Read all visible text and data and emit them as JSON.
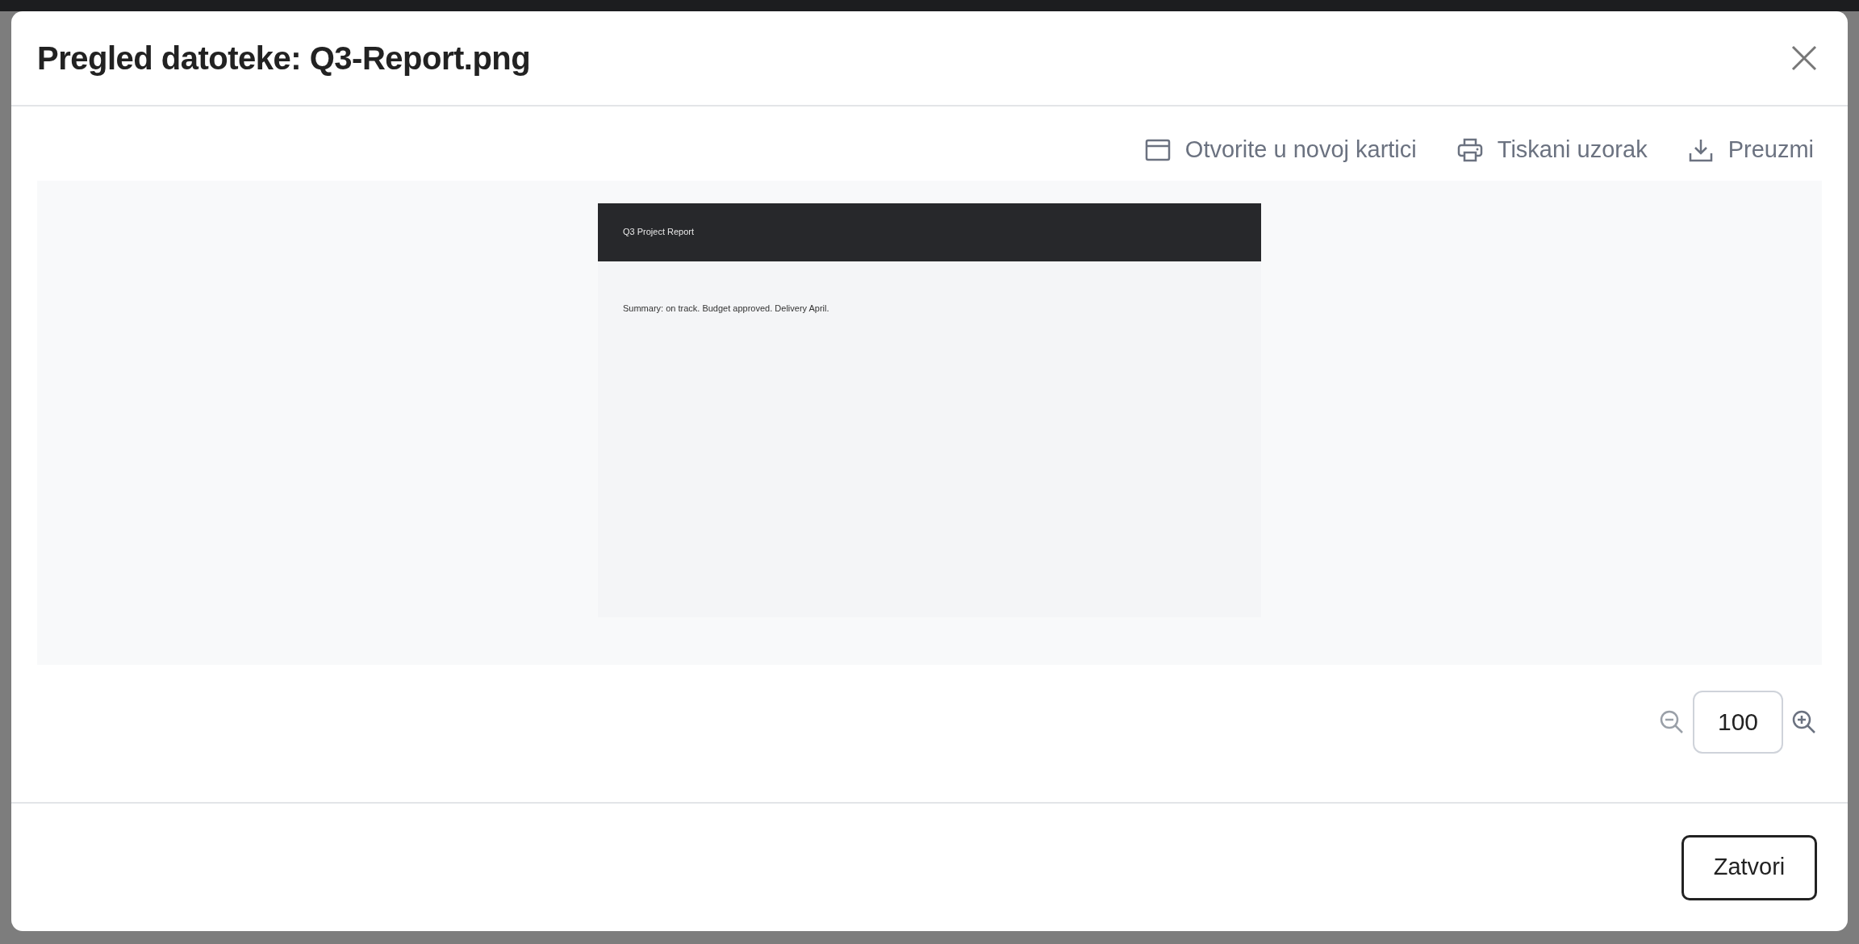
{
  "dialog": {
    "title": "Pregled datoteke: Q3-Report.png",
    "actions": [
      {
        "kind": "window",
        "label": "Otvorite u novoj kartici"
      },
      {
        "kind": "print",
        "label": "Tiskani uzorak"
      },
      {
        "kind": "download",
        "label": "Preuzmi"
      }
    ],
    "preview": {
      "header": "Q3 Project Report",
      "body": "Summary: on track. Budget approved. Delivery April."
    },
    "zoom": {
      "value": "100"
    },
    "buttons": [
      "Zatvori"
    ]
  }
}
